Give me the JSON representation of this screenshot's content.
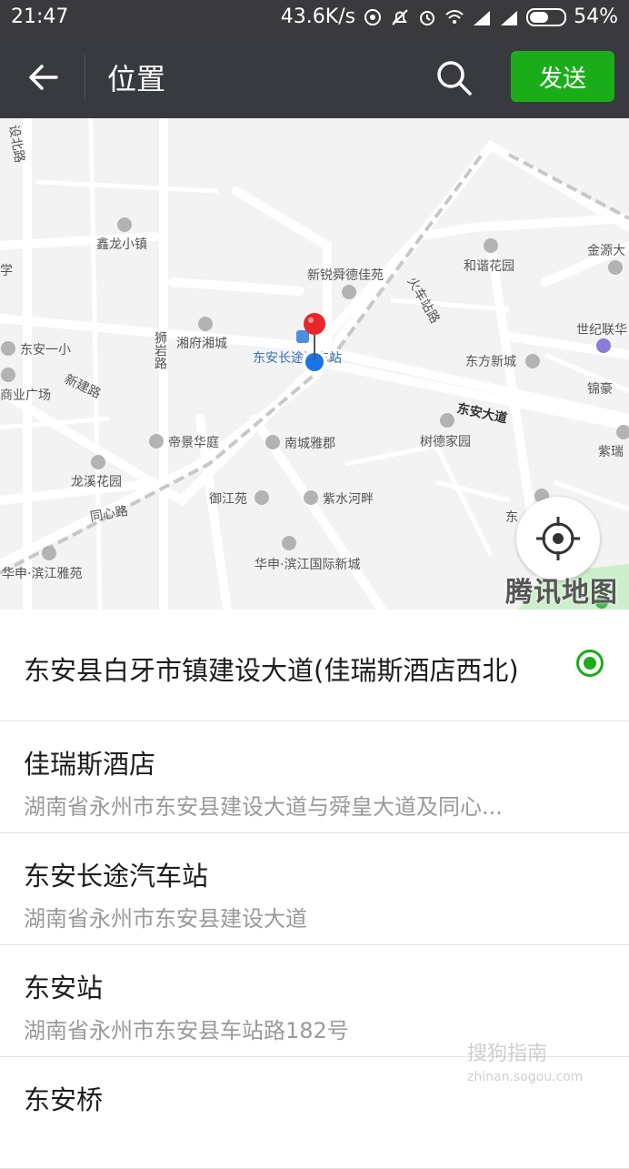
{
  "status_bar": {
    "time": "21:47",
    "network_speed": "43.6K/s",
    "battery": "54%",
    "battery_level": 0.54
  },
  "header": {
    "title": "位置",
    "send_label": "发送"
  },
  "map": {
    "brand": "腾讯地图",
    "labels": [
      "设北路",
      "鑫龙小镇",
      "新锐舜德佳苑",
      "和谐花园",
      "金源大",
      "学",
      "东安一小",
      "狮岩路",
      "湘府湘城",
      "东安长途汽车站",
      "火车站路",
      "世纪联华",
      "东方新城",
      "锦豪",
      "商业广场",
      "新建路",
      "东安大道",
      "树德家园",
      "紫瑞",
      "帝景华庭",
      "南城雅郡",
      "龙溪花园",
      "御江苑",
      "紫水河畔",
      "同心路",
      "华申·滨江雅苑",
      "华申·滨江国际新城",
      "东"
    ]
  },
  "locations": {
    "selected": "东安县白牙市镇建设大道(佳瑞斯酒店西北)",
    "items": [
      {
        "name": "佳瑞斯酒店",
        "address": "湖南省永州市东安县建设大道与舜皇大道及同心..."
      },
      {
        "name": "东安长途汽车站",
        "address": "湖南省永州市东安县建设大道"
      },
      {
        "name": "东安站",
        "address": "湖南省永州市东安县车站路182号"
      },
      {
        "name": "东安桥",
        "address": ""
      }
    ]
  },
  "watermark": {
    "text": "搜狗指南",
    "url": "zhinan.sogou.com"
  },
  "colors": {
    "header_bg": "#393a3f",
    "status_bg": "#3a3a3c",
    "accent_green": "#1aad19",
    "pin_red": "#e8262b",
    "location_blue": "#1a73e8"
  }
}
